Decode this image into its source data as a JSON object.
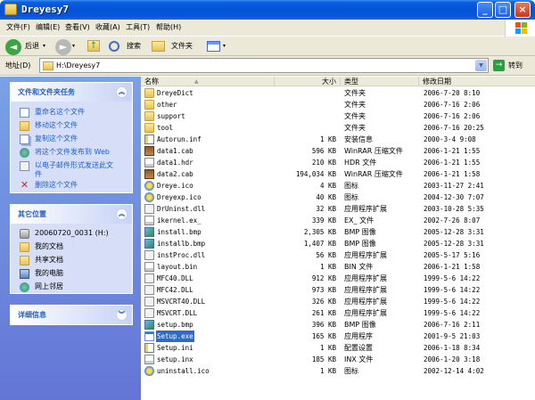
{
  "window": {
    "title": "Dreyesy7"
  },
  "menus": [
    "文件(F)",
    "编辑(E)",
    "查看(V)",
    "收藏(A)",
    "工具(T)",
    "帮助(H)"
  ],
  "toolbar": {
    "back": "后退",
    "search": "搜索",
    "folders": "文件夹"
  },
  "address": {
    "label": "地址(D)",
    "value": "H:\\Dreyesy7",
    "go": "转到"
  },
  "tasks": {
    "title": "文件和文件夹任务",
    "items": [
      "重命名这个文件",
      "移动这个文件",
      "复制这个文件",
      "将这个文件发布到 Web",
      "以电子邮件形式发送此文件",
      "删除这个文件"
    ]
  },
  "other": {
    "title": "其它位置",
    "items": [
      "20060720_0031 (H:)",
      "我的文档",
      "共享文档",
      "我的电脑",
      "网上邻居"
    ]
  },
  "details": {
    "title": "详细信息"
  },
  "columns": {
    "name": "名称",
    "size": "大小",
    "type": "类型",
    "date": "修改日期"
  },
  "files": [
    {
      "name": "DreyeDict",
      "size": "",
      "type": "文件夹",
      "date": "2006-7-20 8:10",
      "icon": "folder"
    },
    {
      "name": "other",
      "size": "",
      "type": "文件夹",
      "date": "2006-7-16 2:06",
      "icon": "folder"
    },
    {
      "name": "support",
      "size": "",
      "type": "文件夹",
      "date": "2006-7-16 2:06",
      "icon": "folder"
    },
    {
      "name": "tool",
      "size": "",
      "type": "文件夹",
      "date": "2006-7-16 20:25",
      "icon": "folder"
    },
    {
      "name": "Autorun.inf",
      "size": "1 KB",
      "type": "安装信息",
      "date": "2000-3-4 9:08",
      "icon": "ini"
    },
    {
      "name": "data1.cab",
      "size": "596 KB",
      "type": "WinRAR 压缩文件",
      "date": "2006-1-21 1:55",
      "icon": "cab"
    },
    {
      "name": "data1.hdr",
      "size": "210 KB",
      "type": "HDR 文件",
      "date": "2006-1-21 1:55",
      "icon": "txt"
    },
    {
      "name": "data2.cab",
      "size": "194,034 KB",
      "type": "WinRAR 压缩文件",
      "date": "2006-1-21 1:58",
      "icon": "cab"
    },
    {
      "name": "Dreye.ico",
      "size": "4 KB",
      "type": "图标",
      "date": "2003-11-27 2:41",
      "icon": "ico"
    },
    {
      "name": "Dreyexp.ico",
      "size": "40 KB",
      "type": "图标",
      "date": "2004-12-30 7:07",
      "icon": "ico"
    },
    {
      "name": "DrUninst.dll",
      "size": "32 KB",
      "type": "应用程序扩展",
      "date": "2003-10-28 5:35",
      "icon": "dll"
    },
    {
      "name": "ikernel.ex_",
      "size": "339 KB",
      "type": "EX_ 文件",
      "date": "2002-7-26 8:07",
      "icon": "txt"
    },
    {
      "name": "install.bmp",
      "size": "2,305 KB",
      "type": "BMP 图像",
      "date": "2005-12-28 3:31",
      "icon": "bmp"
    },
    {
      "name": "installb.bmp",
      "size": "1,407 KB",
      "type": "BMP 图像",
      "date": "2005-12-28 3:31",
      "icon": "bmp"
    },
    {
      "name": "instProc.dll",
      "size": "56 KB",
      "type": "应用程序扩展",
      "date": "2005-5-17 5:16",
      "icon": "dll"
    },
    {
      "name": "layout.bin",
      "size": "1 KB",
      "type": "BIN 文件",
      "date": "2006-1-21 1:58",
      "icon": "txt"
    },
    {
      "name": "MFC40.DLL",
      "size": "912 KB",
      "type": "应用程序扩展",
      "date": "1999-5-6 14:22",
      "icon": "dll"
    },
    {
      "name": "MFC42.DLL",
      "size": "973 KB",
      "type": "应用程序扩展",
      "date": "1999-5-6 14:22",
      "icon": "dll"
    },
    {
      "name": "MSVCRT40.DLL",
      "size": "326 KB",
      "type": "应用程序扩展",
      "date": "1999-5-6 14:22",
      "icon": "dll"
    },
    {
      "name": "MSVCRT.DLL",
      "size": "261 KB",
      "type": "应用程序扩展",
      "date": "1999-5-6 14:22",
      "icon": "dll"
    },
    {
      "name": "setup.bmp",
      "size": "396 KB",
      "type": "BMP 图像",
      "date": "2006-7-16 2:11",
      "icon": "bmp"
    },
    {
      "name": "Setup.exe",
      "size": "165 KB",
      "type": "应用程序",
      "date": "2001-9-5 21:03",
      "icon": "exe",
      "selected": true
    },
    {
      "name": "Setup.ini",
      "size": "1 KB",
      "type": "配置设置",
      "date": "2006-1-18 8:34",
      "icon": "ini"
    },
    {
      "name": "setup.inx",
      "size": "185 KB",
      "type": "INX 文件",
      "date": "2006-1-20 3:18",
      "icon": "txt"
    },
    {
      "name": "uninstall.ico",
      "size": "1 KB",
      "type": "图标",
      "date": "2002-12-14 4:02",
      "icon": "ico"
    }
  ]
}
